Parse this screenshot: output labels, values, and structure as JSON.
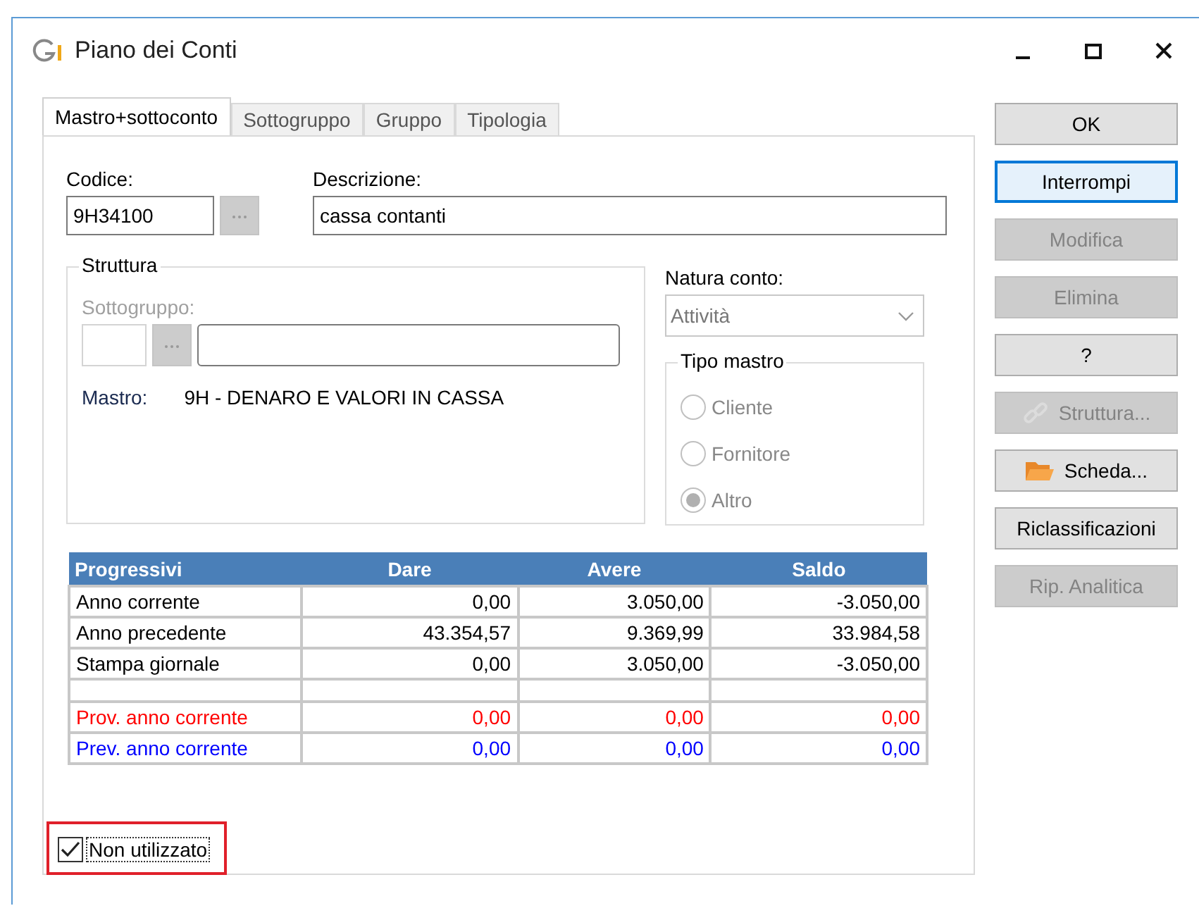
{
  "window": {
    "title": "Piano dei Conti"
  },
  "tabs": [
    {
      "label": "Mastro+sottoconto",
      "selected": true
    },
    {
      "label": "Sottogruppo",
      "selected": false
    },
    {
      "label": "Gruppo",
      "selected": false
    },
    {
      "label": "Tipologia",
      "selected": false
    }
  ],
  "codice": {
    "label": "Codice:",
    "value": "9H34100"
  },
  "descrizione": {
    "label": "Descrizione:",
    "value": "cassa contanti"
  },
  "struttura": {
    "title": "Struttura",
    "sottogruppo_label": "Sottogruppo:",
    "disabled": true,
    "mastro_label": "Mastro:",
    "mastro_value": "9H - DENARO E VALORI IN CASSA"
  },
  "natura_conto": {
    "label": "Natura conto:",
    "value": "Attività",
    "disabled": true
  },
  "tipo_mastro": {
    "title": "Tipo mastro",
    "options": [
      {
        "label": "Cliente",
        "selected": false,
        "disabled": true
      },
      {
        "label": "Fornitore",
        "selected": false,
        "disabled": true
      },
      {
        "label": "Altro",
        "selected": true,
        "disabled": true
      }
    ]
  },
  "table": {
    "columns": [
      "Progressivi",
      "Dare",
      "Avere",
      "Saldo"
    ],
    "rows": [
      {
        "kind": "data",
        "color": "#000000",
        "cells": [
          "Anno corrente",
          "0,00",
          "3.050,00",
          "-3.050,00"
        ]
      },
      {
        "kind": "data",
        "color": "#000000",
        "cells": [
          "Anno precedente",
          "43.354,57",
          "9.369,99",
          "33.984,58"
        ]
      },
      {
        "kind": "data",
        "color": "#000000",
        "cells": [
          "Stampa giornale",
          "0,00",
          "3.050,00",
          "-3.050,00"
        ]
      },
      {
        "kind": "blank"
      },
      {
        "kind": "data",
        "color": "#ff0000",
        "cells": [
          "Prov. anno corrente",
          "0,00",
          "0,00",
          "0,00"
        ]
      },
      {
        "kind": "data",
        "color": "#0000ff",
        "cells": [
          "Prev. anno corrente",
          "0,00",
          "0,00",
          "0,00"
        ]
      }
    ]
  },
  "non_utilizzato": {
    "label": "Non utilizzato",
    "checked": true,
    "highlighted": true
  },
  "buttons": [
    {
      "label": "OK",
      "kind": "plain",
      "disabled": false,
      "focused": false
    },
    {
      "label": "Interrompi",
      "kind": "plain",
      "disabled": false,
      "focused": true
    },
    {
      "label": "Modifica",
      "kind": "plain",
      "disabled": true,
      "focused": false
    },
    {
      "label": "Elimina",
      "kind": "plain",
      "disabled": true,
      "focused": false
    },
    {
      "label": "?",
      "kind": "plain",
      "disabled": false,
      "focused": false
    },
    {
      "label": "Struttura...",
      "kind": "chain",
      "disabled": true,
      "focused": false
    },
    {
      "label": "Scheda...",
      "kind": "folder",
      "disabled": false,
      "focused": false
    },
    {
      "label": "Riclassificazioni",
      "kind": "plain",
      "disabled": false,
      "focused": false
    },
    {
      "label": "Rip. Analitica",
      "kind": "plain",
      "disabled": true,
      "focused": false
    }
  ]
}
